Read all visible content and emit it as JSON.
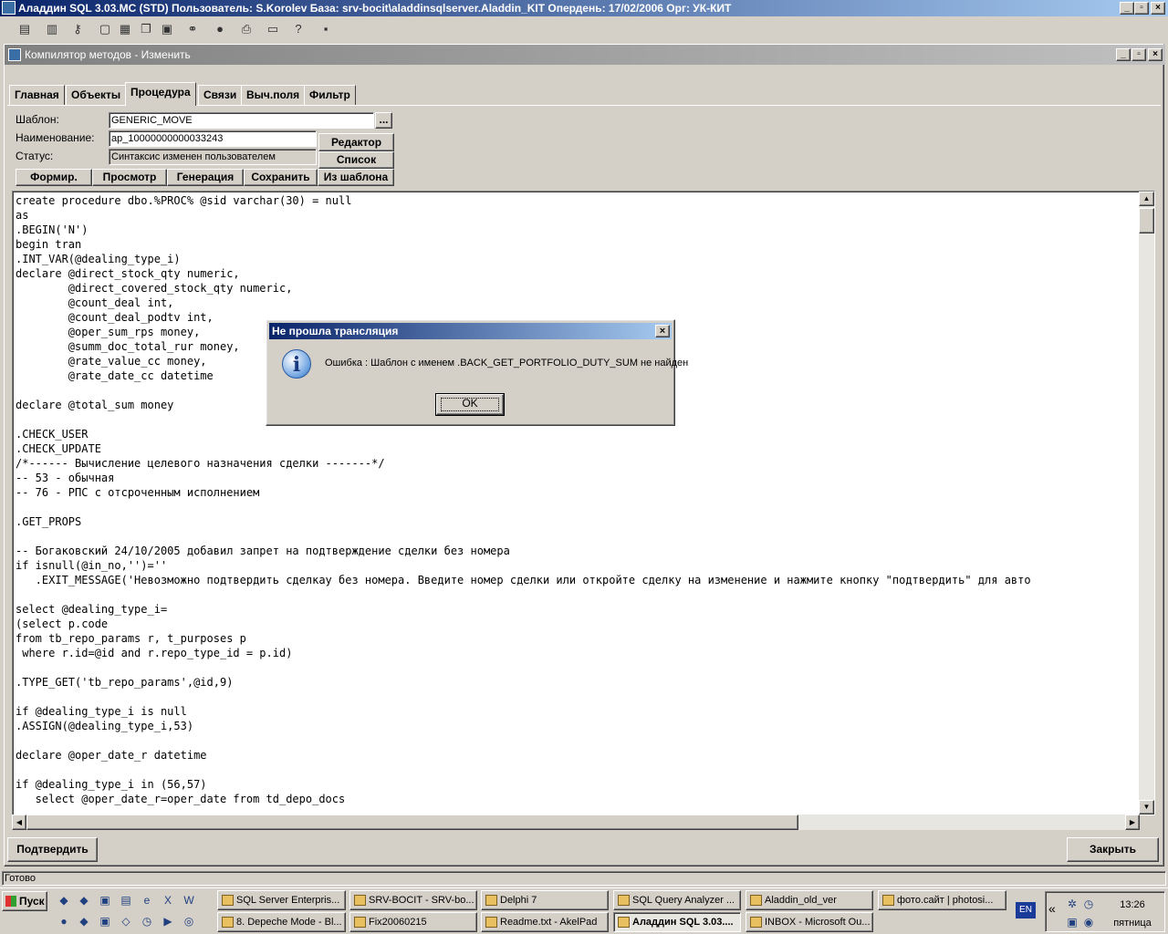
{
  "app": {
    "title": "Аладдин SQL 3.03.MC (STD)  Пользователь: S.Korolev База: srv-bocit\\aladdinsqlserver.Aladdin_KIT Опердень: 17/02/2006 Орг: УК-КИТ",
    "minimize": "_",
    "maximize": "▫",
    "close": "×"
  },
  "toolbar": {
    "icons": [
      "doc-icon",
      "db-icon",
      "key-icon",
      "window-icon",
      "tile-icon",
      "cascade-icon",
      "copy-icon",
      "binoculars-icon",
      "stop-icon",
      "printer-icon",
      "folder-icon",
      "help-icon",
      "exit-icon"
    ]
  },
  "child_window": {
    "title": "Компилятор методов - Изменить"
  },
  "tabs": [
    "Главная",
    "Объекты",
    "Процедура",
    "Связи",
    "Выч.поля",
    "Фильтр"
  ],
  "active_tab": "Процедура",
  "form": {
    "template_label": "Шаблон:",
    "template_value": "GENERIC_MOVE",
    "browse_label": "...",
    "name_label": "Наименование:",
    "name_value": "ap_10000000000033243",
    "status_label": "Статус:",
    "status_value": "Синтаксис изменен пользователем",
    "editor_btn": "Редактор",
    "list_btn": "Список",
    "actions": [
      "Формир.",
      "Просмотр",
      "Генерация",
      "Сохранить",
      "Из шаблона"
    ]
  },
  "code": [
    "create procedure dbo.%PROC% @sid varchar(30) = null",
    "as",
    ".BEGIN('N')",
    "begin tran",
    ".INT_VAR(@dealing_type_i)",
    "declare @direct_stock_qty numeric,",
    "        @direct_covered_stock_qty numeric,",
    "        @count_deal int,",
    "        @count_deal_podtv int,",
    "        @oper_sum_rps money,",
    "        @summ_doc_total_rur money,",
    "        @rate_value_cc money,",
    "        @rate_date_cc datetime",
    "",
    "declare @total_sum money",
    "",
    ".CHECK_USER",
    ".CHECK_UPDATE",
    "/*------ Вычисление целевого назначения сделки -------*/",
    "-- 53 - обычная",
    "-- 76 - РПС с отсроченным исполнением",
    "",
    ".GET_PROPS",
    "",
    "-- Богаковский 24/10/2005 добавил запрет на подтверждение сделки без номера",
    "if isnull(@in_no,'')=''",
    "   .EXIT_MESSAGE('Невозможно подтвердить сделкау без номера. Введите номер сделки или откройте сделку на изменение и нажмите кнопку \"подтвердить\" для авто",
    "",
    "select @dealing_type_i=",
    "(select p.code",
    "from tb_repo_params r, t_purposes p",
    " where r.id=@id and r.repo_type_id = p.id)",
    "",
    ".TYPE_GET('tb_repo_params',@id,9)",
    "",
    "if @dealing_type_i is null",
    ".ASSIGN(@dealing_type_i,53)",
    "",
    "declare @oper_date_r datetime",
    "",
    "if @dealing_type_i in (56,57)",
    "   select @oper_date_r=oper_date from td_depo_docs"
  ],
  "dialog": {
    "title": "Не прошла трансляция",
    "message": "Ошибка : Шаблон с именем .BACK_GET_PORTFOLIO_DUTY_SUM не найден",
    "ok": "OK",
    "close": "×"
  },
  "bottom": {
    "confirm": "Подтвердить",
    "close": "Закрыть"
  },
  "status": "Готово",
  "taskbar": {
    "start": "Пуск",
    "tasks_row1": [
      "SQL Server Enterpris...",
      "SRV-BOCIT - SRV-bo...",
      "Delphi 7",
      "SQL Query Analyzer ...",
      "Aladdin_old_ver",
      "фото.сайт | photosi..."
    ],
    "tasks_row2": [
      "8. Depeche Mode - Bl...",
      "Fix20060215",
      "Readme.txt - AkelPad",
      "Аладдин SQL 3.03....",
      "INBOX - Microsoft Ou..."
    ],
    "lang": "EN",
    "chevron": "«",
    "time": "13:26",
    "weekday": "пятница"
  }
}
